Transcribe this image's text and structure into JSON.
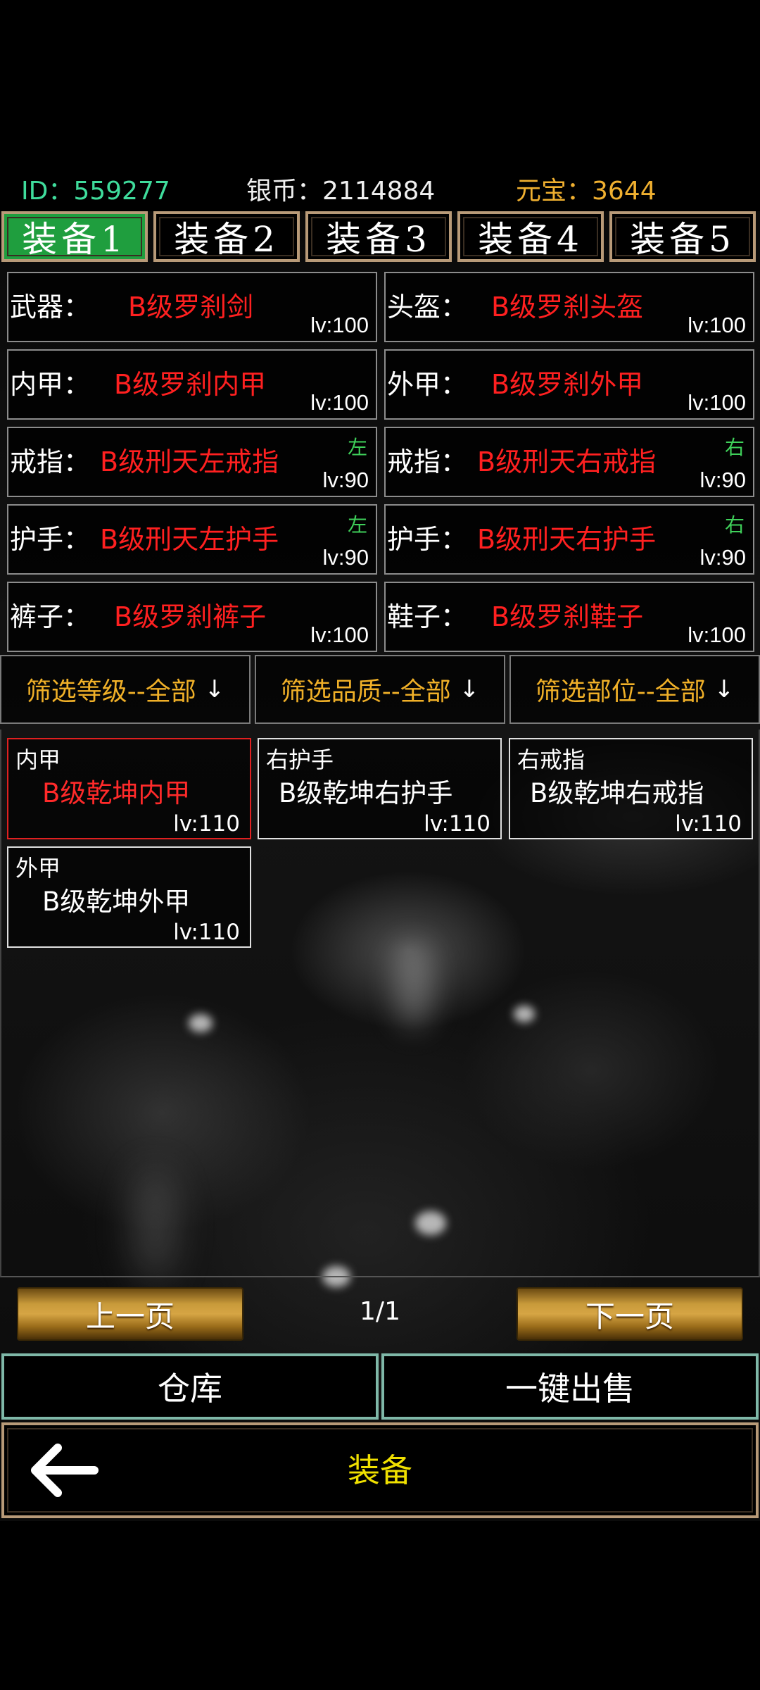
{
  "header": {
    "id": "ID：559277",
    "silver": "银币：2114884",
    "gold": "元宝：3644"
  },
  "tabs": [
    {
      "label": "装备1",
      "active": true
    },
    {
      "label": "装备2",
      "active": false
    },
    {
      "label": "装备3",
      "active": false
    },
    {
      "label": "装备4",
      "active": false
    },
    {
      "label": "装备5",
      "active": false
    }
  ],
  "slots": [
    {
      "label": "武器：",
      "name": "B级罗刹剑",
      "level": "lv:100",
      "side": ""
    },
    {
      "label": "头盔：",
      "name": "B级罗刹头盔",
      "level": "lv:100",
      "side": ""
    },
    {
      "label": "内甲：",
      "name": "B级罗刹内甲",
      "level": "lv:100",
      "side": ""
    },
    {
      "label": "外甲：",
      "name": "B级罗刹外甲",
      "level": "lv:100",
      "side": ""
    },
    {
      "label": "戒指：",
      "name": "B级刑天左戒指",
      "level": "lv:90",
      "side": "左"
    },
    {
      "label": "戒指：",
      "name": "B级刑天右戒指",
      "level": "lv:90",
      "side": "右"
    },
    {
      "label": "护手：",
      "name": "B级刑天左护手",
      "level": "lv:90",
      "side": "左"
    },
    {
      "label": "护手：",
      "name": "B级刑天右护手",
      "level": "lv:90",
      "side": "右"
    },
    {
      "label": "裤子：",
      "name": "B级罗刹裤子",
      "level": "lv:100",
      "side": ""
    },
    {
      "label": "鞋子：",
      "name": "B级罗刹鞋子",
      "level": "lv:100",
      "side": ""
    }
  ],
  "filters": [
    {
      "label": "筛选等级--全部",
      "icon": "arrow-down-icon"
    },
    {
      "label": "筛选品质--全部",
      "icon": "arrow-down-icon"
    },
    {
      "label": "筛选部位--全部",
      "icon": "arrow-down-icon"
    }
  ],
  "inventory": [
    {
      "type": "内甲",
      "name": "B级乾坤内甲",
      "level": "lv:110",
      "selected": true
    },
    {
      "type": "右护手",
      "name": "B级乾坤右护手",
      "level": "lv:110",
      "selected": false
    },
    {
      "type": "右戒指",
      "name": "B级乾坤右戒指",
      "level": "lv:110",
      "selected": false
    },
    {
      "type": "外甲",
      "name": "B级乾坤外甲",
      "level": "lv:110",
      "selected": false
    }
  ],
  "pager": {
    "prev": "上一页",
    "next": "下一页",
    "page": "1/1"
  },
  "actions": {
    "warehouse": "仓库",
    "sell_all": "一键出售"
  },
  "nav": {
    "title": "装备",
    "back_icon": "arrow-left-icon"
  },
  "colors": {
    "active_tab": "#1f9e3e",
    "equipped_name": "#ff2020",
    "filter_text": "#f0b028",
    "nav_title": "#f0e000",
    "id_text": "#3fdc9c",
    "gold_text": "#f0b030"
  }
}
